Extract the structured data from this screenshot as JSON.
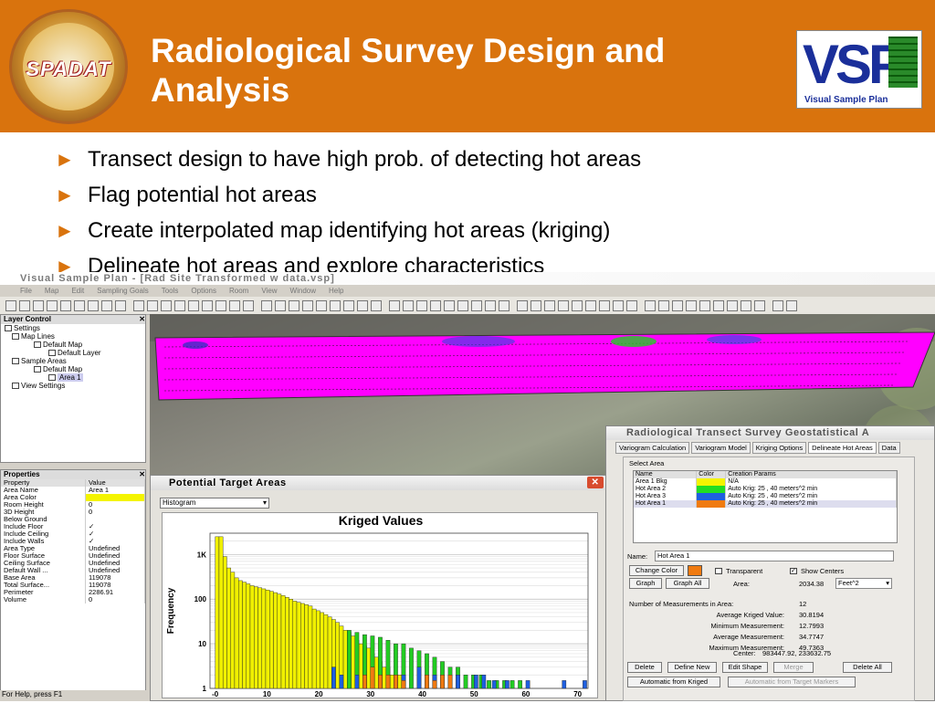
{
  "slide": {
    "title": "Radiological Survey Design and Analysis",
    "left_logo_text": "SPADAT",
    "right_logo_text": "VSP",
    "right_logo_caption": "Visual Sample Plan",
    "bullets": [
      "Transect design to have high prob. of detecting hot areas",
      "Flag potential hot areas",
      "Create interpolated map identifying hot areas (kriging)",
      "Delineate hot areas and explore characteristics"
    ],
    "bullet_icon": "right-triangle-bullet-icon"
  },
  "app": {
    "window_title": "Visual Sample Plan - [Rad Site Transformed w data.vsp]",
    "menus": [
      "File",
      "Map",
      "Edit",
      "Sampling Goals",
      "Tools",
      "Options",
      "Room",
      "View",
      "Window",
      "Help"
    ],
    "status_text": "For Help, press F1",
    "layer_control": {
      "title": "Layer Control",
      "close": "✕",
      "tree": [
        "Settings",
        "Map Lines",
        "Default Map",
        "Default Layer",
        "Sample Areas",
        "Default Map",
        "Area 1",
        "View Settings"
      ]
    },
    "properties": {
      "title": "Properties",
      "headers": [
        "Property",
        "Value"
      ],
      "rows": [
        [
          "Area Name",
          "Area 1"
        ],
        [
          "Area Color",
          ""
        ],
        [
          "Room Height",
          "0"
        ],
        [
          "3D Height",
          "0"
        ],
        [
          "Below Ground",
          ""
        ],
        [
          "Include Floor",
          "✓"
        ],
        [
          "Include Ceiling",
          "✓"
        ],
        [
          "Include Walls",
          "✓"
        ],
        [
          "Area Type",
          "Undefined"
        ],
        [
          "Floor Surface",
          "Undefined"
        ],
        [
          "Ceiling Surface",
          "Undefined"
        ],
        [
          "Default Wall ...",
          "Undefined"
        ],
        [
          "Base Area",
          "119078"
        ],
        [
          "Total Surface...",
          "119078"
        ],
        [
          "Perimeter",
          "2286.91"
        ],
        [
          "Volume",
          "0"
        ]
      ],
      "area_color": "#f4f400"
    }
  },
  "pta": {
    "title": "Potential Target Areas",
    "select_value": "Histogram",
    "close": "✕"
  },
  "geo": {
    "title": "Radiological Transect Survey Geostatistical A",
    "tabs": [
      "Variogram Calculation",
      "Variogram Model",
      "Kriging Options",
      "Delineate Hot Areas",
      "Data"
    ],
    "group_label": "Select Area",
    "grid_headers": [
      "Name",
      "Color",
      "Creation Params"
    ],
    "grid_rows": [
      {
        "name": "Area 1 Bkg",
        "color": "#f4f400",
        "params": "N/A"
      },
      {
        "name": "Hot Area 2",
        "color": "#22dd22",
        "params": "Auto Krig: 25 , 40 meters^2 min"
      },
      {
        "name": "Hot Area 3",
        "color": "#1e5fe0",
        "params": "Auto Krig: 25 , 40 meters^2 min"
      },
      {
        "name": "Hot Area 1",
        "color": "#f07a10",
        "params": "Auto Krig: 25 , 40 meters^2 min"
      }
    ],
    "name_label": "Name:",
    "name_value": "Hot Area 1",
    "change_color": "Change Color",
    "transparent": "Transparent",
    "show_centers": "Show Centers",
    "graph": "Graph",
    "graph_all": "Graph All",
    "area_label": "Area:",
    "area_value": "2034.38",
    "units": "Feet^2",
    "stats": [
      {
        "label": "Number of Measurements in Area:",
        "value": "12"
      },
      {
        "label": "Average Kriged Value:",
        "value": "30.8194"
      },
      {
        "label": "Minimum Measurement:",
        "value": "12.7993"
      },
      {
        "label": "Average Measurement:",
        "value": "34.7747"
      },
      {
        "label": "Maximum Measurement:",
        "value": "49.7363"
      }
    ],
    "center_label": "Center:",
    "center_value": "983447.92, 233632.75",
    "buttons": [
      "Delete",
      "Define New",
      "Edit Shape",
      "Merge",
      "Delete All"
    ],
    "auto_kriged": "Automatic from Kriged",
    "auto_markers": "Automatic from Target Markers"
  },
  "chart_data": {
    "type": "bar",
    "title": "Kriged Values",
    "ylabel": "Frequency",
    "xlabel": "",
    "y_scale": "log",
    "ylim": [
      1,
      3000
    ],
    "y_ticks": [
      "1K",
      "100",
      "10",
      "1"
    ],
    "x_ticks": [
      "-0",
      "10",
      "20",
      "30",
      "40",
      "50",
      "60",
      "70"
    ],
    "xlim": [
      -1,
      72
    ],
    "bin_width": 0.75,
    "series": [
      {
        "name": "Area 1 Bkg",
        "color": "#f0f000",
        "values": [
          [
            0.0,
            2500
          ],
          [
            0.75,
            2500
          ],
          [
            1.5,
            900
          ],
          [
            2.25,
            500
          ],
          [
            3.0,
            400
          ],
          [
            3.75,
            300
          ],
          [
            4.5,
            260
          ],
          [
            5.25,
            240
          ],
          [
            6.0,
            220
          ],
          [
            6.75,
            200
          ],
          [
            7.5,
            190
          ],
          [
            8.25,
            180
          ],
          [
            9.0,
            170
          ],
          [
            9.75,
            160
          ],
          [
            10.5,
            150
          ],
          [
            11.25,
            140
          ],
          [
            12.0,
            130
          ],
          [
            12.75,
            120
          ],
          [
            13.5,
            110
          ],
          [
            14.25,
            100
          ],
          [
            15.0,
            90
          ],
          [
            15.75,
            85
          ],
          [
            16.5,
            80
          ],
          [
            17.25,
            75
          ],
          [
            18.0,
            70
          ],
          [
            18.75,
            60
          ],
          [
            19.5,
            55
          ],
          [
            20.25,
            50
          ],
          [
            21.0,
            45
          ],
          [
            21.75,
            40
          ],
          [
            22.5,
            35
          ],
          [
            23.25,
            30
          ],
          [
            24.0,
            25
          ],
          [
            24.75,
            20
          ],
          [
            25.5,
            18
          ],
          [
            26.25,
            15
          ],
          [
            27.0,
            12
          ],
          [
            27.75,
            10
          ],
          [
            28.5,
            9
          ],
          [
            29.25,
            8
          ],
          [
            30.0,
            6
          ],
          [
            30.75,
            5
          ],
          [
            31.5,
            4
          ],
          [
            32.25,
            3
          ],
          [
            33.0,
            3
          ],
          [
            33.75,
            2
          ],
          [
            34.5,
            2
          ],
          [
            35.25,
            2
          ]
        ]
      },
      {
        "name": "Hot Area 2",
        "color": "#22cc22",
        "values": [
          [
            25.5,
            20
          ],
          [
            27.0,
            18
          ],
          [
            28.5,
            16
          ],
          [
            30.0,
            15
          ],
          [
            31.5,
            14
          ],
          [
            33.0,
            12
          ],
          [
            34.5,
            10
          ],
          [
            36.0,
            10
          ],
          [
            37.5,
            8
          ],
          [
            39.0,
            7
          ],
          [
            40.5,
            6
          ],
          [
            42.0,
            5
          ],
          [
            43.5,
            4
          ],
          [
            45.0,
            3
          ],
          [
            46.5,
            3
          ],
          [
            48.0,
            2
          ],
          [
            49.5,
            2
          ],
          [
            51.0,
            2
          ],
          [
            52.5,
            1.5
          ],
          [
            54.0,
            1.5
          ],
          [
            55.5,
            1.5
          ],
          [
            57.0,
            1.5
          ],
          [
            58.5,
            1.5
          ]
        ]
      },
      {
        "name": "Hot Area 3",
        "color": "#1e5fe0",
        "values": [
          [
            22.5,
            3
          ],
          [
            24.0,
            2
          ],
          [
            27.0,
            2
          ],
          [
            36.0,
            2
          ],
          [
            39.0,
            3
          ],
          [
            42.0,
            2
          ],
          [
            46.5,
            2
          ],
          [
            50.0,
            2
          ],
          [
            51.5,
            2
          ],
          [
            53.5,
            1.5
          ],
          [
            56.0,
            1.5
          ],
          [
            60.0,
            1.5
          ],
          [
            67.0,
            1.5
          ],
          [
            71.0,
            1.5
          ]
        ]
      },
      {
        "name": "Hot Area 1",
        "color": "#f07a10",
        "values": [
          [
            28.5,
            2
          ],
          [
            30.0,
            3
          ],
          [
            31.5,
            2
          ],
          [
            33.0,
            2
          ],
          [
            34.5,
            2
          ],
          [
            36.0,
            1.5
          ],
          [
            40.5,
            2
          ],
          [
            42.0,
            1.5
          ],
          [
            43.5,
            2
          ],
          [
            45.0,
            2
          ]
        ]
      }
    ]
  }
}
